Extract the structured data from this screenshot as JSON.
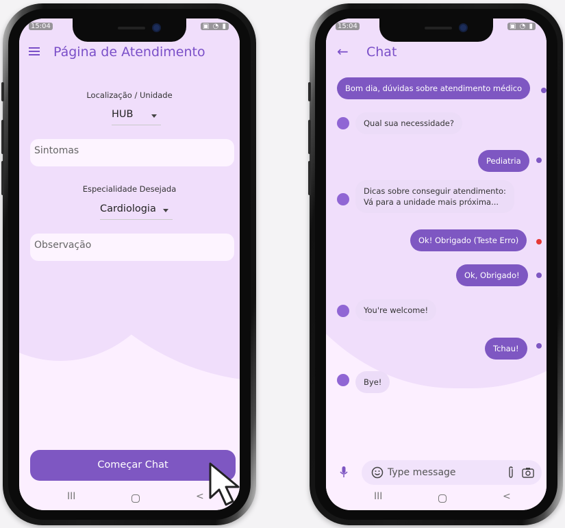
{
  "left_phone": {
    "status_time": "15:04",
    "title": "Página de Atendimento",
    "location_label": "Localização / Unidade",
    "location_value": "HUB",
    "symptoms_placeholder": "Sintomas",
    "specialty_label": "Especialidade Desejada",
    "specialty_value": "Cardiologia",
    "notes_placeholder": "Observação",
    "start_chat_label": "Começar Chat"
  },
  "right_phone": {
    "status_time": "15:04",
    "title": "Chat",
    "messages": [
      {
        "side": "sent",
        "text": "Bom dia, dúvidas sobre atendimento médico",
        "status": "ok"
      },
      {
        "side": "recv",
        "text": "Qual sua necessidade?"
      },
      {
        "side": "sent",
        "text": "Pediatria",
        "status": "ok"
      },
      {
        "side": "recv",
        "text": "Dicas sobre conseguir atendimento:\nVá para a unidade mais próxima..."
      },
      {
        "side": "sent",
        "text": "Ok! Obrigado (Teste Erro)",
        "status": "error"
      },
      {
        "side": "sent",
        "text": "Ok, Obrigado!",
        "status": "ok"
      },
      {
        "side": "recv",
        "text": "You're welcome!"
      },
      {
        "side": "sent",
        "text": "Tchau!",
        "status": "ok"
      },
      {
        "side": "recv",
        "text": "Bye!"
      }
    ],
    "input_placeholder": "Type message"
  },
  "nav": {
    "recents": "III",
    "back": "<"
  },
  "colors": {
    "accent": "#7e57c2",
    "background": "#fcefff",
    "blob": "#f0defb",
    "error": "#e53935"
  },
  "icons": [
    "menu-icon",
    "dropdown-caret-icon",
    "back-arrow-icon",
    "mic-icon",
    "emoji-icon",
    "attach-icon",
    "camera-icon",
    "cursor-icon"
  ]
}
